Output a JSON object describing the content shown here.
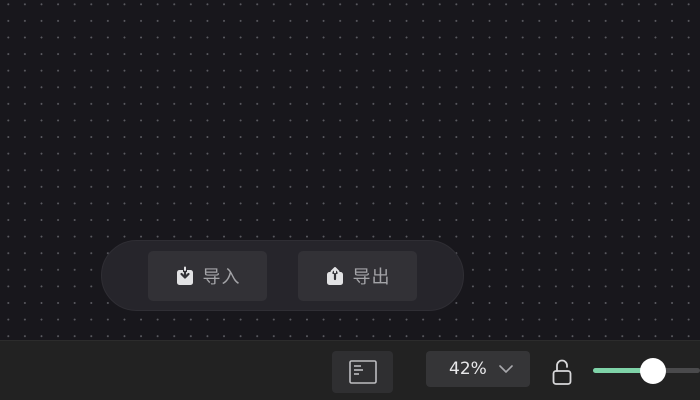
{
  "actions": {
    "import_label": "导入",
    "export_label": "导出"
  },
  "toolbar": {
    "minimap_icon": "minimap-icon",
    "zoom_value": "42%",
    "lock_icon": "unlocked-padlock-icon",
    "slider_level": 0.56
  },
  "colors": {
    "canvas_bg": "#18171c",
    "accent": "#7fd3a8",
    "bar_bg": "#222222"
  }
}
